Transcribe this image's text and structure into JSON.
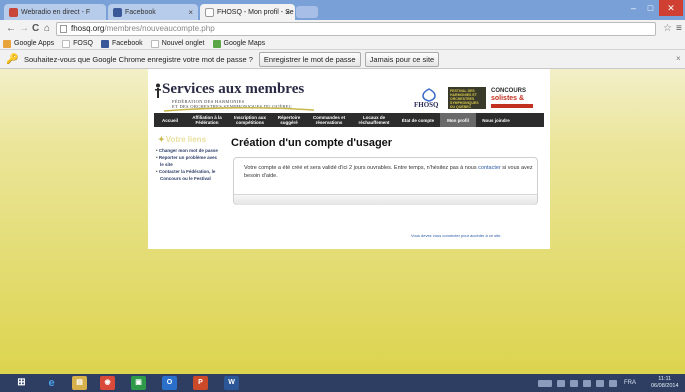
{
  "browser": {
    "tabs": [
      {
        "title": "Webradio en direct - F",
        "active": false,
        "favicon_color": "#c8463a"
      },
      {
        "title": "Facebook",
        "active": false,
        "favicon_color": "#3b5998"
      },
      {
        "title": "FHOSQ - Mon profil - Se",
        "active": true,
        "favicon_color": "#999999"
      }
    ],
    "tab_close": "×",
    "window_controls": {
      "minimize": "–",
      "maximize": "□",
      "close": "✕"
    },
    "nav": {
      "back": "←",
      "forward": "→",
      "reload": "C",
      "home": "⌂"
    },
    "url_host": "fhosq.org",
    "url_path": "/membres/nouveaucompte.php",
    "star": "☆",
    "menu": "≡",
    "bookmarks": [
      {
        "label": "Google Apps",
        "icon_color": "#e8a33a"
      },
      {
        "label": "FOSQ",
        "icon_color": "#bbbbbb"
      },
      {
        "label": "Facebook",
        "icon_color": "#3b5998"
      },
      {
        "label": "Nouvel onglet",
        "icon_color": "#dddddd"
      },
      {
        "label": "Google Maps",
        "icon_color": "#5aa646"
      }
    ],
    "infobar": {
      "text": "Souhaitez-vous que Google Chrome enregistre votre mot de passe ?",
      "save_button": "Enregistrer le mot de passe",
      "never_button": "Jamais pour ce site",
      "close": "×"
    }
  },
  "site": {
    "title": "Services aux membres",
    "subtitle_line1": "FÉDÉRATION DES HARMONIES",
    "subtitle_line2": "ET DES ORCHESTRES SYMPHONIQUES DU QUÉBEC",
    "logo_fhosq": "FHOSQ",
    "logo_festival": "FESTIVAL DES HARMONIES ET ORCHESTRES SYMPHONIQUES DU QUÉBEC",
    "logo_concours_line1": "CONCOURS",
    "logo_concours_line2": "solistes &",
    "nav": [
      {
        "label": "Accueil",
        "active": false
      },
      {
        "label": "Affiliation à la Fédération",
        "active": false
      },
      {
        "label": "Inscription aux compétitions",
        "active": false
      },
      {
        "label": "Répertoire suggéré",
        "active": false
      },
      {
        "label": "Commandes et réservations",
        "active": false
      },
      {
        "label": "Locaux de réchauffement",
        "active": false
      },
      {
        "label": "État de compte",
        "active": false
      },
      {
        "label": "Mon profil",
        "active": true
      },
      {
        "label": "Nous joindre",
        "active": false
      }
    ],
    "sidebar": {
      "title": "Votre liens",
      "links": [
        "Changer mon mot de passe",
        "Reporter un problème avec le site",
        "Contacter la Fédération, le Concours ou le Festival"
      ]
    },
    "page_title": "Création d'un compte d'usager",
    "message_before": "Votre compte a été créé et sera validé d'ici 2 jours ouvrables. Entre temps, n'hésitez pas à nous ",
    "message_link": "contacter",
    "message_after": " si vous avez besoin d'aide.",
    "login_note": "Vous devez vous connecter pour accéder à ce site."
  },
  "taskbar": {
    "apps": [
      {
        "name": "start",
        "color": "#3a7bd5",
        "glyph": "⊞"
      },
      {
        "name": "internet-explorer",
        "color": "#1f79d0",
        "glyph": "e"
      },
      {
        "name": "file-explorer",
        "color": "#d6b04a",
        "glyph": "▤"
      },
      {
        "name": "chrome",
        "color": "#d94a3a",
        "glyph": "◉"
      },
      {
        "name": "store",
        "color": "#2f9a4a",
        "glyph": "▣"
      },
      {
        "name": "outlook",
        "color": "#2a6fc9",
        "glyph": "O"
      },
      {
        "name": "powerpoint",
        "color": "#cc4a2a",
        "glyph": "P"
      },
      {
        "name": "word",
        "color": "#2b5797",
        "glyph": "W"
      }
    ],
    "language": "FRA",
    "time": "11:11",
    "date": "06/08/2014"
  }
}
